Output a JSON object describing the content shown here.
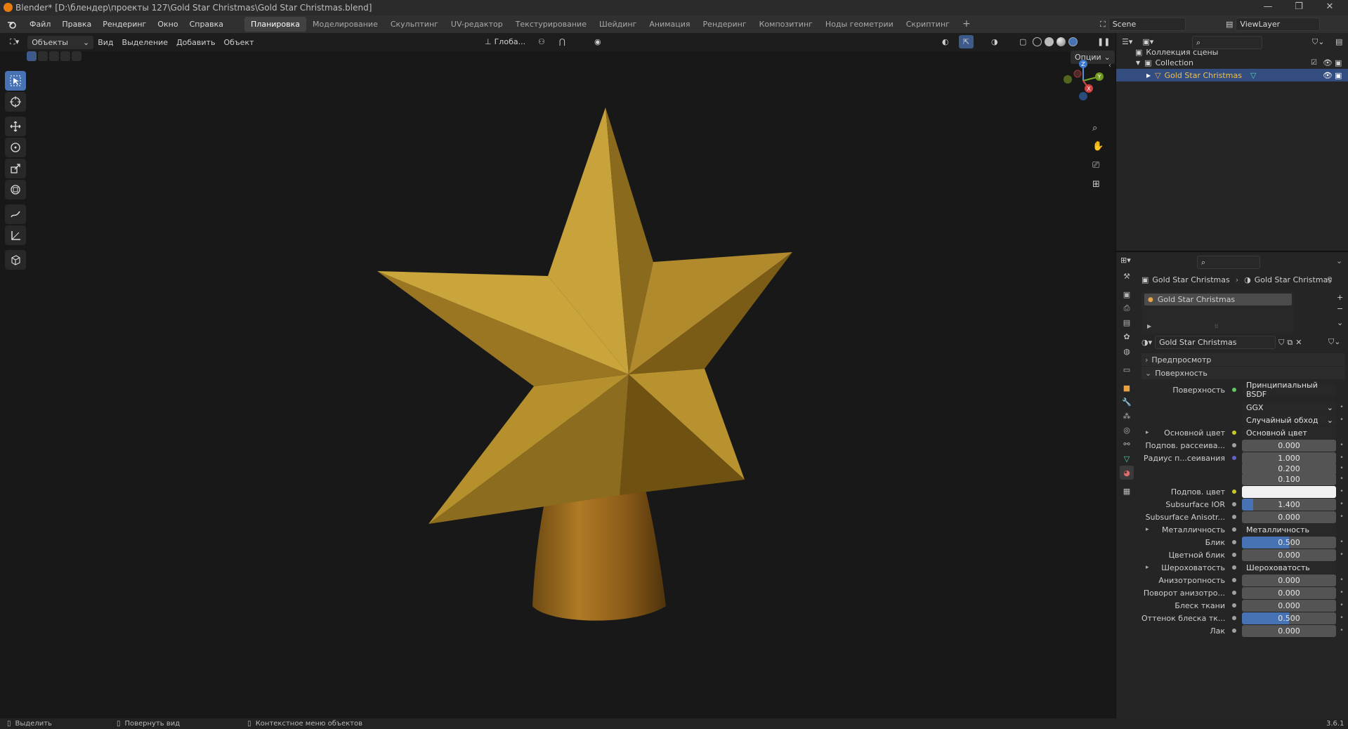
{
  "window": {
    "title": "Blender* [D:\\блендер\\проекты 127\\Gold Star Christmas\\Gold Star Christmas.blend]",
    "controls": [
      "—",
      "❐",
      "✕"
    ]
  },
  "menubar": {
    "menus": [
      "Файл",
      "Правка",
      "Рендеринг",
      "Окно",
      "Справка"
    ],
    "workspaces": [
      "Планировка",
      "Моделирование",
      "Скульптинг",
      "UV-редактор",
      "Текстурирование",
      "Шейдинг",
      "Анимация",
      "Рендеринг",
      "Композитинг",
      "Ноды геометрии",
      "Скриптинг"
    ],
    "active_workspace": 0,
    "add_tab": "+",
    "scene": "Scene",
    "view_layer": "ViewLayer"
  },
  "viewport_header": {
    "mode": "Объекты",
    "menus": [
      "Вид",
      "Выделение",
      "Добавить",
      "Объект"
    ],
    "transform_orientation": "Глоба...",
    "options": "Опции"
  },
  "gizmo": {
    "x": "X",
    "y": "Y",
    "z": "Z"
  },
  "outliner": {
    "rows": [
      {
        "label": "Коллекция сцены"
      },
      {
        "label": "Collection"
      },
      {
        "label": "Gold Star Christmas"
      }
    ]
  },
  "properties": {
    "breadcrumb": [
      "Gold Star Christmas",
      "Gold Star Christmas"
    ],
    "material_slot": "Gold Star Christmas",
    "material_name": "Gold Star Christmas",
    "panels": {
      "preview": "Предпросмотр",
      "surface": "Поверхность"
    },
    "rows": [
      {
        "label": "Поверхность",
        "type": "socket",
        "value": "Принципиальный BSDF",
        "dot": "green"
      },
      {
        "label": "",
        "type": "dropdown",
        "value": "GGX"
      },
      {
        "label": "",
        "type": "dropdown",
        "value": "Случайный обход"
      },
      {
        "label": "Основной цвет",
        "type": "socket",
        "value": "Основной цвет",
        "dot": "yellow",
        "expand": true
      },
      {
        "label": "Подпов. рассеива...",
        "type": "num",
        "value": "0.000",
        "dot": "gray",
        "fill": 0
      },
      {
        "label": "Радиус п...сеивания",
        "type": "num",
        "value": "1.000",
        "dot": "blue",
        "fill": 0
      },
      {
        "label": "",
        "type": "num",
        "value": "0.200",
        "fill": 0
      },
      {
        "label": "",
        "type": "num",
        "value": "0.100",
        "fill": 0
      },
      {
        "label": "Подпов. цвет",
        "type": "color",
        "value": "#f0f0f0",
        "dot": "yellow"
      },
      {
        "label": "Subsurface IOR",
        "type": "num",
        "value": "1.400",
        "dot": "gray",
        "fill": 0.12
      },
      {
        "label": "Subsurface Anisotr...",
        "type": "num",
        "value": "0.000",
        "dot": "gray",
        "fill": 0
      },
      {
        "label": "Металличность",
        "type": "socket",
        "value": "Металличность",
        "dot": "gray",
        "expand": true
      },
      {
        "label": "Блик",
        "type": "num",
        "value": "0.500",
        "dot": "gray",
        "fill": 0.5
      },
      {
        "label": "Цветной блик",
        "type": "num",
        "value": "0.000",
        "dot": "gray",
        "fill": 0
      },
      {
        "label": "Шероховатость",
        "type": "socket",
        "value": "Шероховатость",
        "dot": "gray",
        "expand": true
      },
      {
        "label": "Анизотропность",
        "type": "num",
        "value": "0.000",
        "dot": "gray",
        "fill": 0
      },
      {
        "label": "Поворот анизотро...",
        "type": "num",
        "value": "0.000",
        "dot": "gray",
        "fill": 0
      },
      {
        "label": "Блеск ткани",
        "type": "num",
        "value": "0.000",
        "dot": "gray",
        "fill": 0
      },
      {
        "label": "Оттенок блеска тк...",
        "type": "num",
        "value": "0.500",
        "dot": "gray",
        "fill": 0.5
      },
      {
        "label": "Лак",
        "type": "num",
        "value": "0.000",
        "dot": "gray",
        "fill": 0
      }
    ]
  },
  "statusbar": {
    "items": [
      "Выделить",
      "Повернуть вид",
      "Контекстное меню объектов"
    ],
    "version": "3.6.1"
  }
}
